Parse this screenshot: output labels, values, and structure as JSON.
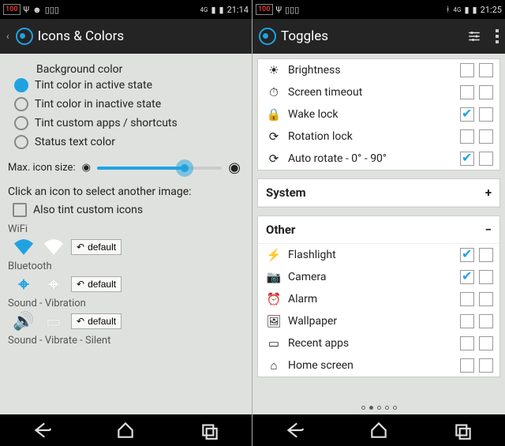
{
  "left": {
    "status": {
      "time": "21:14",
      "battery": "100"
    },
    "title": "Icons & Colors",
    "radios": {
      "bg": "Background color",
      "active": "Tint color in active state",
      "inactive": "Tint color in inactive state",
      "custom": "Tint custom apps / shortcuts",
      "status": "Status text color"
    },
    "slider_label": "Max. icon size:",
    "click_note": "Click an icon to select another image:",
    "also_tint": "Also tint custom icons",
    "sections": {
      "wifi": "WiFi",
      "bluetooth": "Bluetooth",
      "soundvib": "Sound - Vibration",
      "soundvibsilent": "Sound - Vibrate - Silent"
    },
    "default_btn": "default"
  },
  "right": {
    "status": {
      "time": "21:25",
      "battery": "100"
    },
    "title": "Toggles",
    "group_top": [
      {
        "icon": "☀",
        "label": "Brightness",
        "c1": false,
        "c2": false
      },
      {
        "icon": "⏱",
        "label": "Screen timeout",
        "c1": false,
        "c2": false
      },
      {
        "icon": "🔒",
        "label": "Wake lock",
        "c1": true,
        "c2": false
      },
      {
        "icon": "⟳",
        "label": "Rotation lock",
        "c1": false,
        "c2": false
      },
      {
        "icon": "⟳",
        "label": "Auto rotate - 0° - 90°",
        "c1": true,
        "c2": false
      }
    ],
    "system_header": "System",
    "other_header": "Other",
    "group_other": [
      {
        "icon": "⚡",
        "label": "Flashlight",
        "c1": true,
        "c2": false
      },
      {
        "icon": "📷",
        "label": "Camera",
        "c1": true,
        "c2": false
      },
      {
        "icon": "⏰",
        "label": "Alarm",
        "c1": false,
        "c2": false
      },
      {
        "icon": "🖼",
        "label": "Wallpaper",
        "c1": false,
        "c2": false
      },
      {
        "icon": "▭",
        "label": "Recent apps",
        "c1": false,
        "c2": false
      },
      {
        "icon": "⌂",
        "label": "Home screen",
        "c1": false,
        "c2": false
      }
    ]
  }
}
